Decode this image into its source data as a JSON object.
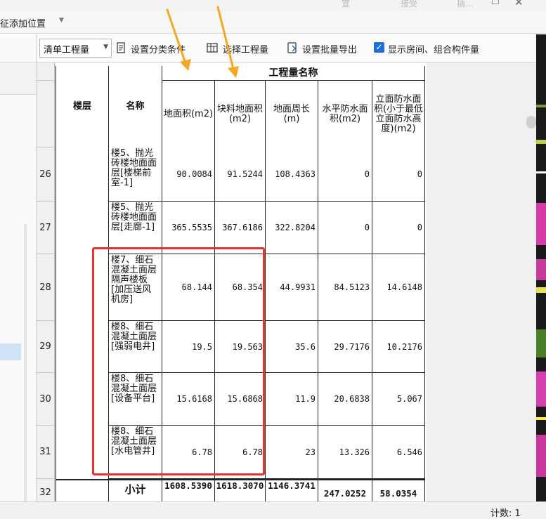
{
  "topbar": {
    "ghost": [
      "宣",
      "接受",
      "插…"
    ]
  },
  "feature_bar": {
    "label": "征添加位置"
  },
  "toolbar": {
    "dropdown_value": "清单工程量",
    "set_category_label": "设置分类条件",
    "select_quantity_label": "选择工程量",
    "batch_export_label": "设置批量导出",
    "show_rooms_label": "显示房间、组合构件量",
    "show_rooms_checked": true
  },
  "table": {
    "group_header": "工程量名称",
    "col_floor": "楼层",
    "col_name": "名称",
    "columns": [
      "地面积(m2)",
      "块料地面积(m2)",
      "地面周长(m)",
      "水平防水面积(m2)",
      "立面防水面积(小于最低立面防水高度)(m2)"
    ],
    "rows": [
      {
        "num": "26",
        "name": "楼5、抛光砖楼地面面层[楼梯前室-1]",
        "values": [
          "90.0084",
          "91.5244",
          "108.4363",
          "0",
          "0"
        ]
      },
      {
        "num": "27",
        "name": "楼5、抛光砖楼地面面层[走廊-1]",
        "values": [
          "365.5535",
          "367.6186",
          "322.8204",
          "0",
          "0"
        ]
      },
      {
        "num": "28",
        "name": "楼7、细石混凝土面层隔声楼板[加压送风机房]",
        "values": [
          "68.144",
          "68.354",
          "44.9931",
          "84.5123",
          "14.6148"
        ]
      },
      {
        "num": "29",
        "name": "楼8、细石混凝土面层[强弱电井]",
        "values": [
          "19.5",
          "19.563",
          "35.6",
          "29.7176",
          "10.2176"
        ]
      },
      {
        "num": "30",
        "name": "楼8、细石混凝土面层[设备平台]",
        "values": [
          "15.6168",
          "15.6868",
          "11.9",
          "20.6838",
          "5.067"
        ]
      },
      {
        "num": "31",
        "name": "楼8、细石混凝土面层[水电管井]",
        "values": [
          "6.78",
          "6.78",
          "23",
          "13.326",
          "6.546"
        ]
      }
    ],
    "subtotal": {
      "num": "32",
      "label": "小计",
      "values": [
        "1608.5390",
        "1618.3070",
        "1146.3741",
        "247.0252",
        "58.0354"
      ]
    }
  },
  "status": {
    "count_text": "计数: 1"
  },
  "colors": {
    "annotation_red": "#e8322d",
    "arrow": "#f5a623",
    "accent": "#1e6fd9"
  }
}
